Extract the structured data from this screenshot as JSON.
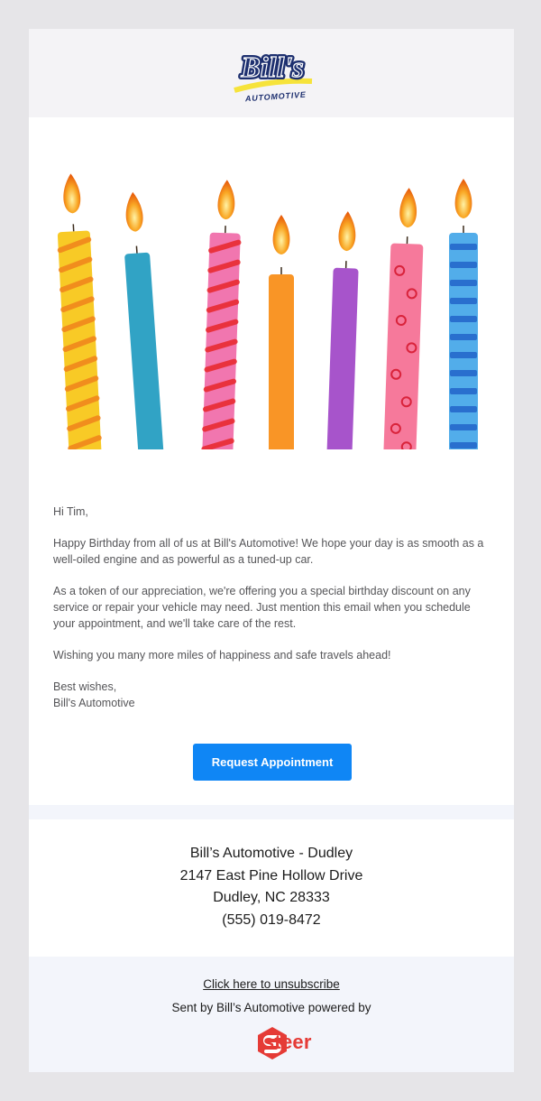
{
  "header": {
    "logo_text": "Bill's",
    "logo_subtext": "AUTOMOTIVE"
  },
  "hero": {
    "candle_colors": [
      "#f7c613",
      "#1f9bc0",
      "#f06aa8",
      "#f98c13",
      "#a045c7",
      "#f56e92",
      "#43a6e8"
    ]
  },
  "email": {
    "greeting": "Hi Tim,",
    "para1_line1": "Happy Birthday from all of us at Bill's Automotive! We hope your day is as smooth as a",
    "para1_line2": "well-oiled engine and as powerful as a tuned-up car.",
    "para2_line1": "As a token of our appreciation, we're offering you a special birthday discount on any",
    "para2_line2": "service or repair your vehicle may need. Just mention this email when you schedule",
    "para2_line3": "your appointment, and we'll take care of the rest.",
    "para3": "Wishing you many more miles of happiness and safe travels ahead!",
    "closing": "Best wishes,",
    "signature": "Bill's Automotive"
  },
  "cta": {
    "label": "Request Appointment",
    "color": "#0f86f5"
  },
  "address": {
    "name": "Bill’s Automotive - Dudley",
    "street": "2147 East Pine Hollow Drive",
    "city": "Dudley, NC 28333",
    "phone": "(555) 019-8472"
  },
  "footer": {
    "unsubscribe": "Click here to unsubscribe",
    "sent_by": "Sent by Bill’s Automotive powered by",
    "brand": "steer",
    "brand_color": "#e53b36"
  }
}
